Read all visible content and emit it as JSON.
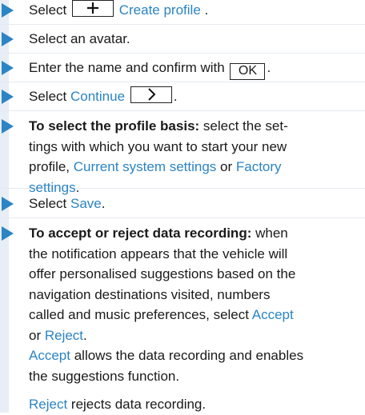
{
  "colors": {
    "link": "#2b84c4",
    "arrow": "#2b84c4",
    "bar": "#e7eef6"
  },
  "icons": {
    "bullet": "right-triangle-icon",
    "plus": "plus-icon",
    "chevron": "chevron-right-icon"
  },
  "steps": {
    "s1": {
      "pre": "Select ",
      "link": "Create profile",
      "post": " ."
    },
    "s2": {
      "text": "Select an avatar."
    },
    "s3": {
      "pre": "Enter the name and confirm with ",
      "button": "OK",
      "post": "."
    },
    "s4": {
      "pre": "Select ",
      "link": "Continue",
      "post": "."
    },
    "s5": {
      "bold": "To select the profile basis:",
      "text1": " select the set-",
      "line2": "tings with which you want to start your new",
      "line3pre": "profile, ",
      "link1": "Current system settings",
      "mid": " or ",
      "link2a": "Factory",
      "link2b": "settings",
      "post": "."
    },
    "s6": {
      "pre": "Select ",
      "link": "Save",
      "post": "."
    },
    "s7": {
      "bold": "To accept or reject data recording:",
      "text1": " when",
      "line2": "the notification appears that the vehicle will",
      "line3": "offer personalised suggestions based on the",
      "line4": "navigation destinations visited, numbers",
      "line5": "called and music preferences, select ",
      "link1": "Accept",
      "line6pre": "or ",
      "link2": "Reject",
      "post": ".",
      "accept_link": "Accept",
      "accept_text1": " allows the data recording and enables",
      "accept_text2": "the suggestions function.",
      "reject_link": "Reject",
      "reject_text": " rejects data recording."
    }
  }
}
